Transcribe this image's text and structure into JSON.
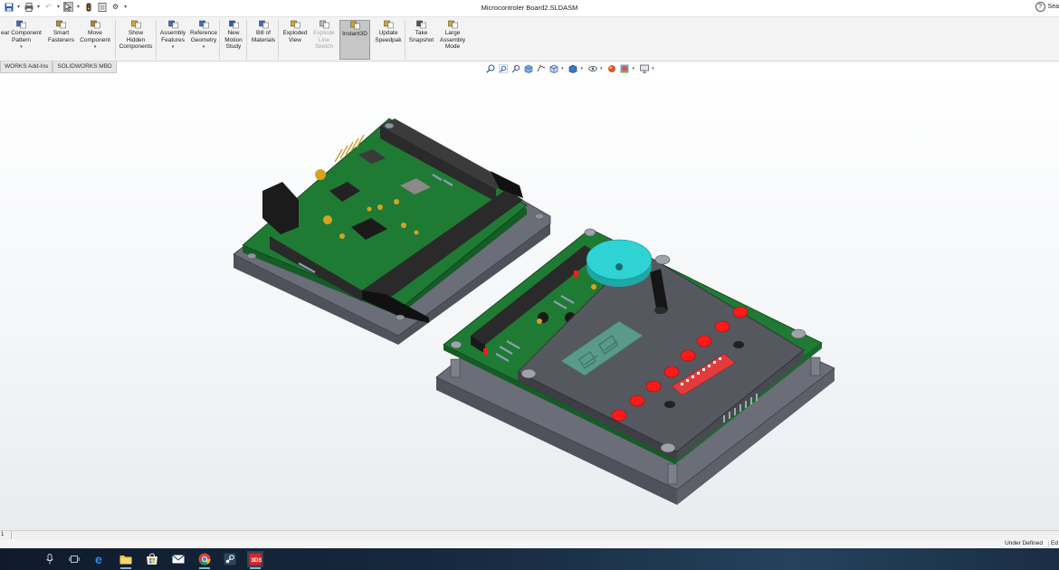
{
  "window": {
    "title": "Microcontroler Board2.SLDASM"
  },
  "help": {
    "search_label": "Sea"
  },
  "ribbon": {
    "buttons": [
      {
        "label": "ear Component\nPattern",
        "dropdown": true
      },
      {
        "label": "Smart\nFasteners"
      },
      {
        "label": "Move\nComponent",
        "dropdown": true
      },
      {
        "label": "Show\nHidden\nComponents"
      },
      {
        "label": "Assembly\nFeatures",
        "dropdown": true
      },
      {
        "label": "Reference\nGeometry",
        "dropdown": true
      },
      {
        "label": "New\nMotion\nStudy"
      },
      {
        "label": "Bill of\nMaterials"
      },
      {
        "label": "Exploded\nView"
      },
      {
        "label": "Explode\nLine\nSketch",
        "disabled": true
      },
      {
        "label": "Instant3D",
        "active": true
      },
      {
        "label": "Update\nSpeedpak"
      },
      {
        "label": "Take\nSnapshot"
      },
      {
        "label": "Large\nAssembly\nMode"
      }
    ]
  },
  "tabs": [
    "WORKS Add-Ins",
    "SOLIDWORKS MBD"
  ],
  "hud": {
    "icons": [
      "zoom-to-fit-icon",
      "zoom-to-area-icon",
      "previous-view-icon",
      "section-view-icon",
      "dynamic-annotation-icon",
      "view-orientation-icon",
      "display-style-icon",
      "hide-show-items-icon",
      "edit-appearance-icon",
      "apply-scene-icon",
      "view-settings-icon"
    ]
  },
  "status": {
    "page": "1",
    "state": "Under Defined",
    "edit": "Ed"
  },
  "taskbar": {
    "icons": [
      "microphone-icon",
      "task-view-icon",
      "edge-icon",
      "file-explorer-icon",
      "store-icon",
      "mail-icon",
      "chrome-icon",
      "steam-icon",
      "solidworks-icon"
    ]
  },
  "colors": {
    "pcb": "#1f7a34",
    "base_plate": "#6b6e78",
    "top_plate": "#55585f",
    "led": "#ff1a1a",
    "buzzer": "#2fd3d3",
    "seven_segment": "#5a9a8a",
    "connector": "#2a2a2a"
  }
}
